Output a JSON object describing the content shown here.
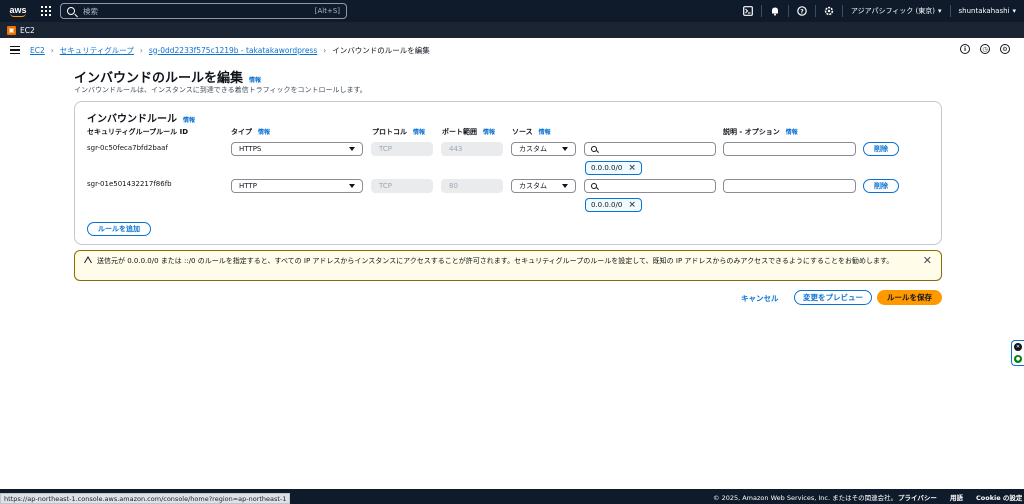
{
  "topnav": {
    "logo_text": "aws",
    "search_placeholder": "検索",
    "search_shortcut": "[Alt+S]",
    "region": "アジアパシフィック (東京)",
    "user": "shuntakahashi",
    "icons": [
      "cloudshell-icon",
      "bell-icon",
      "help-icon",
      "gear-icon"
    ]
  },
  "service": {
    "name": "EC2"
  },
  "breadcrumb": {
    "items": [
      "EC2",
      "セキュリティグループ",
      "sg-0dd2233f575c1219b - takatakawordpress"
    ],
    "current": "インバウンドのルールを編集"
  },
  "header": {
    "title": "インバウンドのルールを編集",
    "info": "情報",
    "description": "インバウンドルールは、インスタンスに到達できる着信トラフィックをコントロールします。"
  },
  "rules_panel": {
    "title": "インバウンドルール",
    "info": "情報",
    "columns": {
      "rule_id": "セキュリティグループルール ID",
      "type": "タイプ",
      "protocol": "プロトコル",
      "port_range": "ポート範囲",
      "source": "ソース",
      "description": "説明 - オプション",
      "info": "情報"
    },
    "rules": [
      {
        "id": "sgr-0c50feca7bfd2baaf",
        "type": "HTTPS",
        "protocol": "TCP",
        "port": "443",
        "source": "カスタム",
        "cidr": "0.0.0.0/0",
        "delete": "削除"
      },
      {
        "id": "sgr-01e501432217f86fb",
        "type": "HTTP",
        "protocol": "TCP",
        "port": "80",
        "source": "カスタム",
        "cidr": "0.0.0.0/0",
        "delete": "削除"
      }
    ],
    "add_rule": "ルールを追加"
  },
  "alert": {
    "message": "送信元が 0.0.0.0/0 または ::/0 のルールを指定すると、すべての IP アドレスからインスタンスにアクセスすることが許可されます。セキュリティグループのルールを設定して、既知の IP アドレスからのみアクセスできるようにすることをお勧めします。"
  },
  "actions": {
    "cancel": "キャンセル",
    "preview": "変更をプレビュー",
    "save": "ルールを保存"
  },
  "footer": {
    "copyright": "© 2025, Amazon Web Services, Inc. またはその関連会社。",
    "privacy": "プライバシー",
    "terms": "用語",
    "cookie": "Cookie の設定"
  },
  "status_url": "https://ap-northeast-1.console.aws.amazon.com/console/home?region=ap-northeast-1",
  "colors": {
    "nav": "#0f1b2a",
    "link": "#0972d3",
    "primary": "#ff9900",
    "warning_border": "#8d6605"
  }
}
